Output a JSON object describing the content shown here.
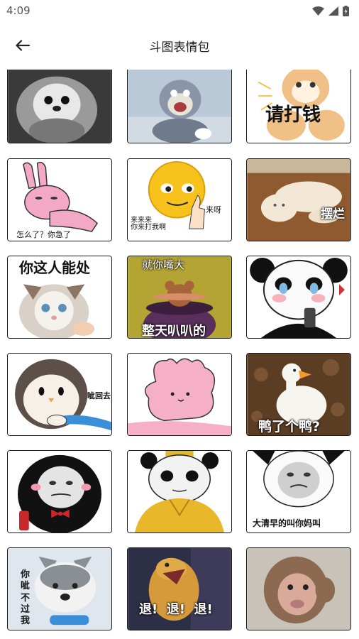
{
  "status": {
    "time": "4:09"
  },
  "header": {
    "title": "斗图表情包"
  },
  "colors": {
    "background": "#ffffff",
    "border": "#1a1a1a"
  },
  "stickers": [
    {
      "id": "penguin-bw",
      "caption": ""
    },
    {
      "id": "tom-cat",
      "caption": ""
    },
    {
      "id": "cat-pay-money",
      "caption": "请打钱",
      "caption_top": ""
    },
    {
      "id": "pink-rabbit",
      "caption": "怎么了？你急了"
    },
    {
      "id": "emoji-face",
      "caption_left": "来来来\n你来打我啊",
      "caption_right": "来呀"
    },
    {
      "id": "lying-cat",
      "caption": "摆烂"
    },
    {
      "id": "cat-you-this-person",
      "caption": "你这人能处"
    },
    {
      "id": "jerry-mouth",
      "caption_top": "就你嘴大",
      "caption_bottom": "整天叭叭的"
    },
    {
      "id": "panda-crying",
      "caption": ""
    },
    {
      "id": "penguin-tube",
      "caption": "呲回去"
    },
    {
      "id": "pink-bunny-doodle",
      "caption": ""
    },
    {
      "id": "duck",
      "caption": "鸭了个鸭?"
    },
    {
      "id": "panda-bow-tie",
      "caption": ""
    },
    {
      "id": "panda-yellow-robe",
      "caption": ""
    },
    {
      "id": "panda-early-morning",
      "caption": "大清早的叫你妈叫"
    },
    {
      "id": "husky-dog",
      "caption": "你\n呲\n不\n过\n我"
    },
    {
      "id": "dog-retreat",
      "caption": "退!  退!  退!"
    },
    {
      "id": "monkey",
      "caption": ""
    }
  ]
}
